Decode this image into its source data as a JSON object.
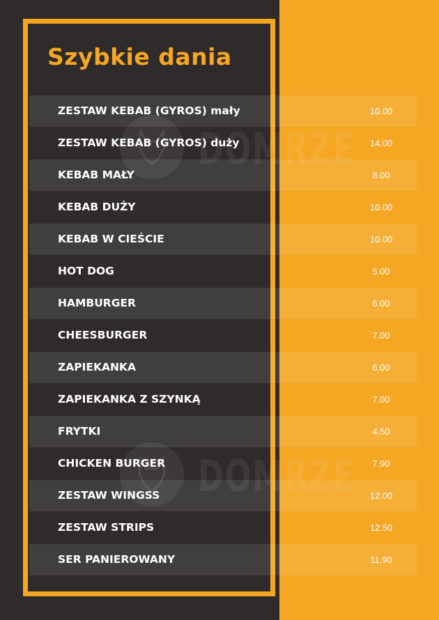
{
  "title": "Szybkie dania",
  "colors": {
    "accent": "#f5a623",
    "background": "#2f2b2b",
    "text": "#ffffff"
  },
  "watermark": {
    "text": "DOMRZE",
    "icon": "dog-head-icon"
  },
  "items": [
    {
      "name": "ZESTAW KEBAB (GYROS) mały",
      "price": "10.00"
    },
    {
      "name": "ZESTAW KEBAB (GYROS) duży",
      "price": "14.00"
    },
    {
      "name": "KEBAB MAŁY",
      "price": "8.00"
    },
    {
      "name": "KEBAB DUŻY",
      "price": "10.00"
    },
    {
      "name": "KEBAB W CIEŚCIE",
      "price": "10.00"
    },
    {
      "name": "HOT DOG",
      "price": "5.00"
    },
    {
      "name": "HAMBURGER",
      "price": "6.00"
    },
    {
      "name": "CHEESBURGER",
      "price": "7.00"
    },
    {
      "name": "ZAPIEKANKA",
      "price": "6.00"
    },
    {
      "name": "ZAPIEKANKA Z SZYNKĄ",
      "price": "7.00"
    },
    {
      "name": "FRYTKI",
      "price": "4.50"
    },
    {
      "name": "CHICKEN BURGER",
      "price": "7.90"
    },
    {
      "name": "ZESTAW WINGSS",
      "price": "12.00"
    },
    {
      "name": "ZESTAW STRIPS",
      "price": "12.50"
    },
    {
      "name": "SER PANIEROWANY",
      "price": "11.90"
    }
  ]
}
